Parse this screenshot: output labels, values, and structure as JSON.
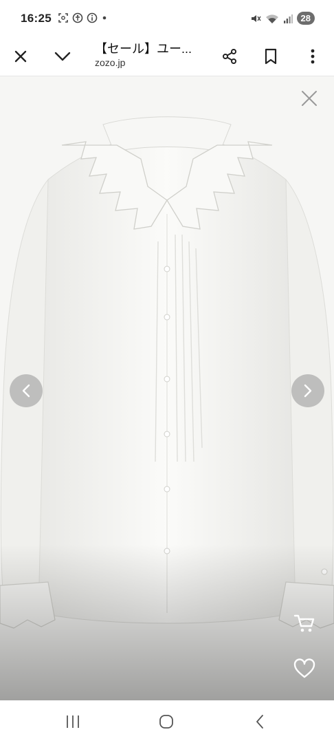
{
  "status_bar": {
    "time": "16:25",
    "battery_level": "28",
    "left_icons": [
      "screenshot-icon",
      "accessibility-icon",
      "info-icon",
      "dot-icon"
    ],
    "right_icons": [
      "mute-icon",
      "wifi-icon",
      "signal-icon"
    ]
  },
  "toolbar": {
    "title": "【セール】ユー...",
    "domain": "zozo.jp",
    "icons": [
      "close-icon",
      "chevron-down-icon",
      "share-icon",
      "bookmark-icon",
      "more-vert-icon"
    ]
  },
  "viewer": {
    "product_image": "white-ruffle-collar-blouse",
    "controls": [
      "close-icon",
      "chevron-left-icon",
      "chevron-right-icon",
      "cart-icon",
      "heart-icon"
    ]
  },
  "nav_bar": {
    "buttons": [
      "recent-apps-icon",
      "home-icon",
      "back-icon"
    ]
  },
  "colors": {
    "background": "#ffffff",
    "image_background": "#f6f6f4",
    "arrow_overlay": "#969696",
    "icon": "#222222",
    "battery_badge": "#6d6d6d"
  }
}
